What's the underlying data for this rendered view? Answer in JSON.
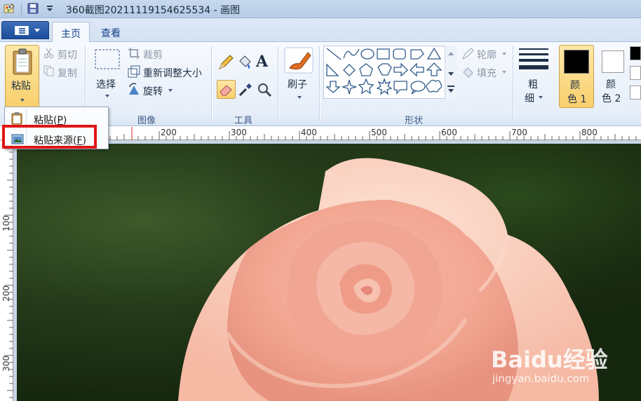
{
  "window": {
    "title": "360截图20211119154625534 - 画图"
  },
  "tabs": [
    {
      "label": "主页",
      "active": true
    },
    {
      "label": "查看",
      "active": false
    }
  ],
  "clipboard": {
    "paste_label": "粘贴",
    "cut_label": "剪切",
    "copy_label": "复制"
  },
  "image_group": {
    "label": "图像",
    "select_label": "选择",
    "crop_label": "裁剪",
    "resize_label": "重新调整大小",
    "rotate_label": "旋转"
  },
  "tools_group": {
    "label": "工具",
    "text_tool": "A"
  },
  "brush": {
    "label": "刷子"
  },
  "shapes_group": {
    "label": "形状",
    "outline_label": "轮廓",
    "fill_label": "填充"
  },
  "size": {
    "label_line1": "粗",
    "label_line2": "细"
  },
  "colors": {
    "color1_line1": "颜",
    "color1_line2": "色 1",
    "color2_line1": "颜",
    "color2_line2": "色 2",
    "color1_value": "#000000",
    "color2_value": "#ffffff"
  },
  "paste_menu": {
    "items": [
      {
        "text": "粘贴",
        "accel": "P"
      },
      {
        "text": "粘贴来源",
        "accel": "F"
      }
    ]
  },
  "ruler": {
    "horizontal": [
      "200",
      "300",
      "400",
      "500",
      "600",
      "700",
      "800"
    ],
    "vertical": [
      "100",
      "200",
      "300"
    ]
  },
  "watermark": {
    "brand": "Baidu经验",
    "url": "jingyan.baidu.com"
  },
  "accent_colors": {
    "highlight_box": "#e01616",
    "pressed_button": "#f9cf6b"
  }
}
